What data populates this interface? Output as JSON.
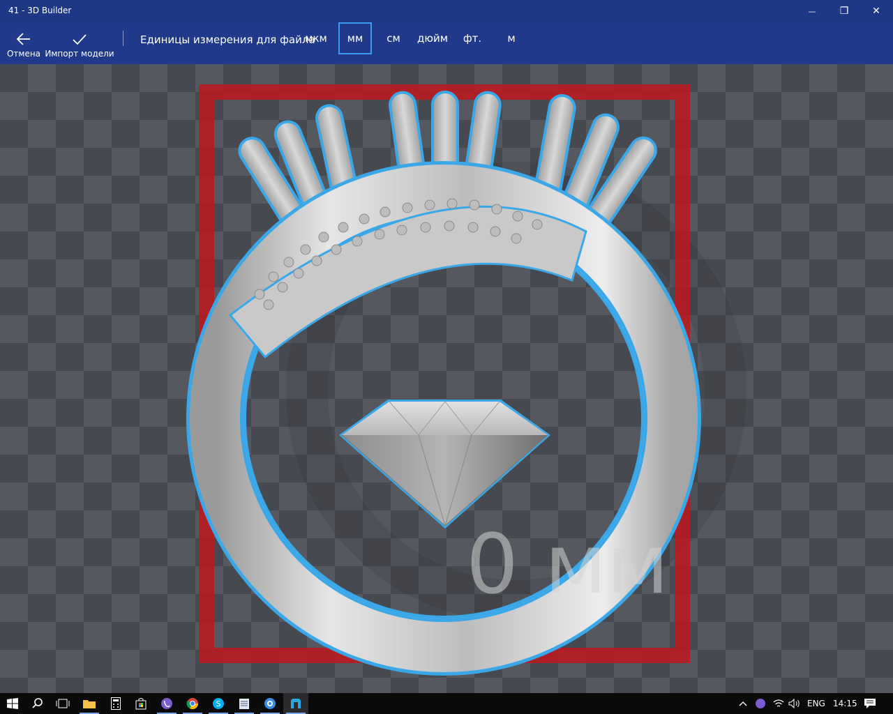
{
  "window": {
    "title": "41 - 3D Builder",
    "minimize_glyph": "—",
    "maximize_glyph": "❐",
    "close_glyph": "✕"
  },
  "toolbar": {
    "cancel_label": "Отмена",
    "import_label": "Импорт модели",
    "units_label": "Единицы измерения для файла",
    "units": [
      "мкм",
      "мм",
      "см",
      "дюйм",
      "фт.",
      "м"
    ],
    "selected_unit": "мм"
  },
  "viewport": {
    "size_readout": "0 мм",
    "bounding_box_color": "#c0171d",
    "selection_outline_color": "#3aa8e8"
  },
  "taskbar": {
    "icons": [
      "windows-start-icon",
      "search-icon",
      "task-view-icon",
      "file-explorer-icon",
      "calculator-icon",
      "store-icon",
      "viber-icon",
      "chrome-icon",
      "skype-icon",
      "notepad-icon",
      "browser-icon",
      "3d-builder-icon"
    ],
    "language": "ENG",
    "time": "14:15"
  }
}
